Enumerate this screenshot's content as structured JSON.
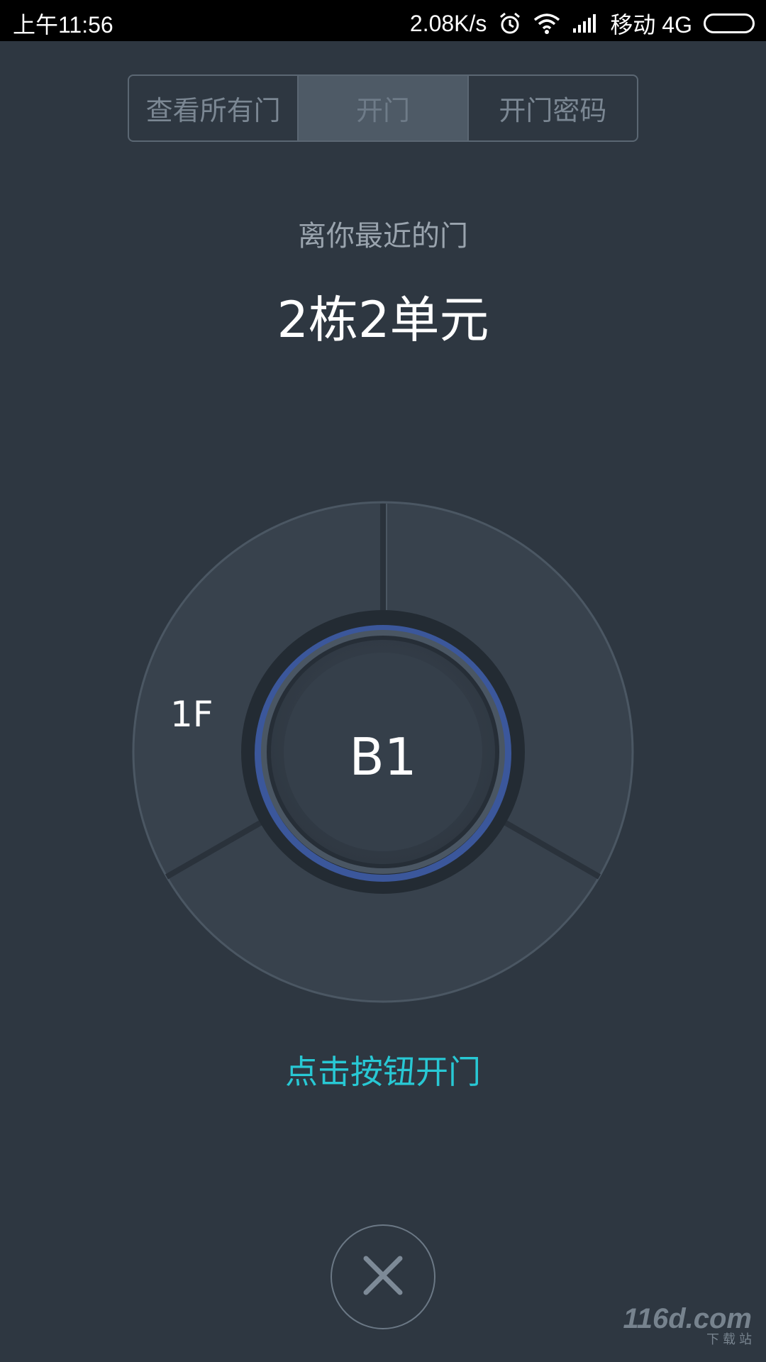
{
  "status_bar": {
    "time": "上午11:56",
    "speed": "2.08K/s",
    "carrier": "移动 4G",
    "icons": [
      "alarm-icon",
      "wifi-icon",
      "signal-icon",
      "battery-icon"
    ]
  },
  "tabs": [
    {
      "label": "查看所有门",
      "active": false
    },
    {
      "label": "开门",
      "active": true
    },
    {
      "label": "开门密码",
      "active": false
    }
  ],
  "main": {
    "subtitle": "离你最近的门",
    "door_name": "2栋2单元",
    "floor_outer": "1F",
    "floor_center": "B1",
    "hint": "点击按钮开门"
  },
  "close_button": {
    "icon": "close-icon"
  },
  "watermark": {
    "text": "116d.com",
    "sub": "下 载 站"
  },
  "colors": {
    "background": "#2e3741",
    "accent": "#28c8d4",
    "ring_blue": "#3f5fae"
  }
}
